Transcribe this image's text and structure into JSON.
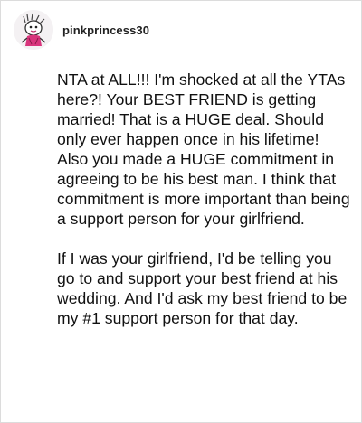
{
  "comment": {
    "username": "pinkprincess30",
    "avatar_icon": "drawn-figure-avatar-icon",
    "paragraphs": [
      "NTA at ALL!!! I'm shocked at all the YTAs here?! Your BEST FRIEND is getting married! That is a HUGE deal. Should only ever happen once in his lifetime! Also you made a HUGE commitment in agreeing to be his best man. I think that commitment is more important than being a support person for your girlfriend.",
      "If I was your girlfriend, I'd be telling you go to and support your best friend at his wedding. And I'd ask my best friend to be my #1 support person for that day."
    ]
  }
}
